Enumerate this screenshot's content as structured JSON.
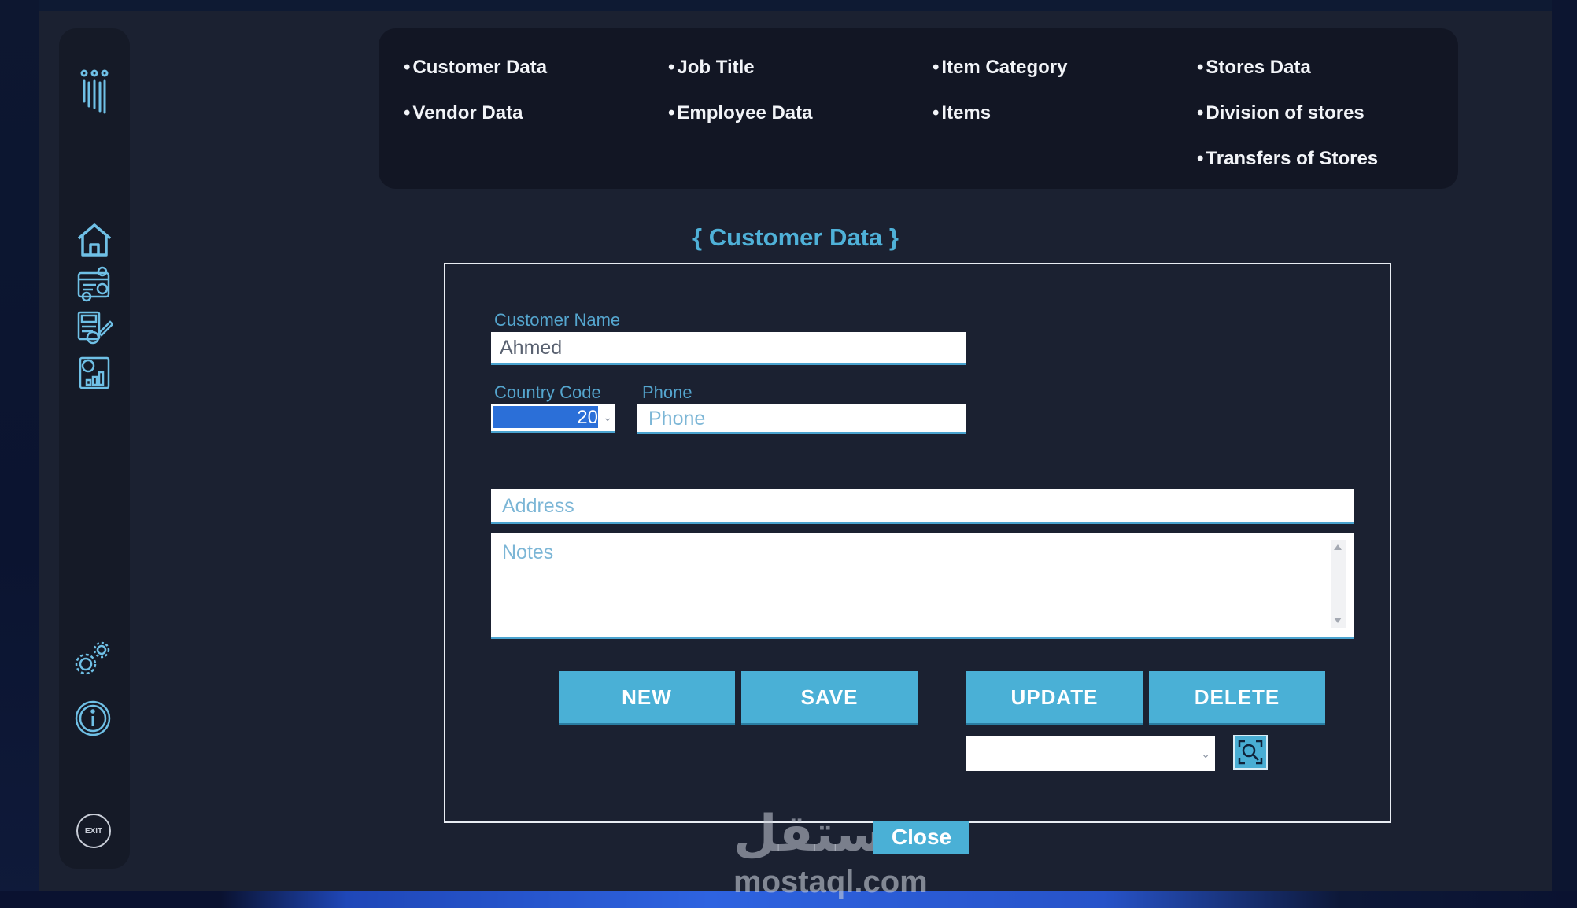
{
  "menu": {
    "col1": [
      "Customer Data",
      "Vendor Data"
    ],
    "col2": [
      "Job Title",
      "Employee Data"
    ],
    "col3": [
      "Item Category",
      "Items"
    ],
    "col4": [
      "Stores Data",
      "Division of stores",
      "Transfers of Stores"
    ]
  },
  "form": {
    "title": "Customer Data",
    "brace_open": "{",
    "brace_close": "}",
    "customer_name_label": "Customer Name",
    "customer_name_value": "Ahmed",
    "country_code_label": "Country Code",
    "country_code_value": "20",
    "phone_label": "Phone",
    "phone_placeholder": "Phone",
    "address_placeholder": "Address",
    "notes_placeholder": "Notes"
  },
  "buttons": {
    "new": "NEW",
    "save": "SAVE",
    "update": "UPDATE",
    "delete": "DELETE",
    "close": "Close"
  },
  "sidebar": {
    "logo_icon": "app-logo-icon",
    "items": [
      "home-icon",
      "reports-icon",
      "invoice-icon",
      "analytics-icon"
    ],
    "settings_icon": "gears-icon",
    "info_icon": "info-icon",
    "exit_label": "EXIT"
  },
  "watermark": {
    "arabic": "مستقل",
    "latin": "mostaql.com"
  },
  "colors": {
    "accent": "#4ab0d6",
    "background": "#1b2131",
    "panel": "#121624",
    "label": "#55a6cf"
  }
}
